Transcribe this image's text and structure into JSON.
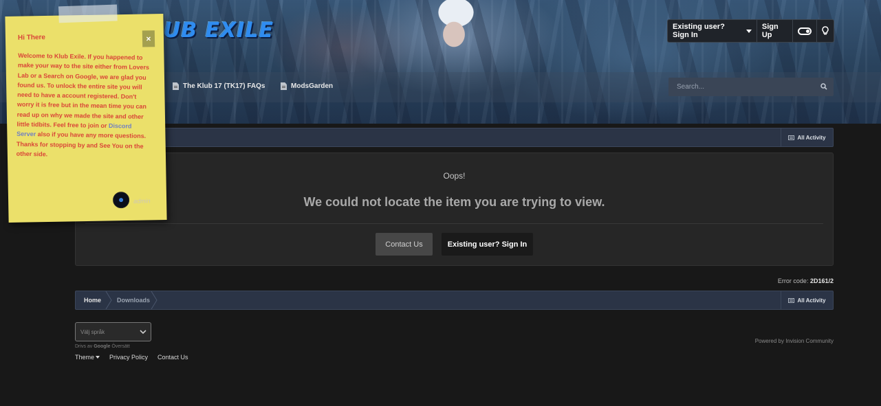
{
  "header": {
    "logo_text": "UB EXILE",
    "user_bar": {
      "sign_in": "Existing user? Sign In",
      "sign_up": "Sign Up"
    },
    "nav": {
      "items": [
        {
          "label": "The Klub 17 (TK17) FAQs",
          "icon": "document-icon"
        },
        {
          "label": "ModsGarden",
          "icon": "document-icon"
        }
      ]
    },
    "search": {
      "placeholder": "Search..."
    }
  },
  "breadcrumb": {
    "home": "Home",
    "downloads": "Downloads",
    "all_activity": "All Activity"
  },
  "error": {
    "oops": "Oops!",
    "message": "We could not locate the item you are trying to view.",
    "contact_button": "Contact Us",
    "signin_button": "Existing user? Sign In",
    "code_label": "Error code:",
    "code_value": "2D161/2"
  },
  "footer": {
    "language_select": "Välj språk",
    "powered_by_google": {
      "prefix": "Drivs av",
      "brand": "Google",
      "suffix": "Översätt"
    },
    "links": {
      "theme": "Theme",
      "privacy": "Privacy Policy",
      "contact": "Contact Us"
    },
    "powered_by": "Powered by Invision Community"
  },
  "sticky_note": {
    "title": "Hi There",
    "body_pre": "Welcome to Klub Exile. If you happened to make your way to the site either from Lovers Lab or a Search on Google, we are glad you found us.  To unlock the entire site you will need to have a account registered.  Don't worry it is free but in the mean time you can read up on why we made the site and other little tidbits.  Feel free to join or ",
    "body_link": "Discord Server",
    "body_post": " also if you have any more questions.  Thanks for stopping by and See You on the other side.",
    "close": "×",
    "author": "admin"
  },
  "colors": {
    "note_bg": "#ebe06a",
    "note_text": "#d94638",
    "breadcrumb_bg": "#2b3446",
    "page_bg": "#181818"
  }
}
